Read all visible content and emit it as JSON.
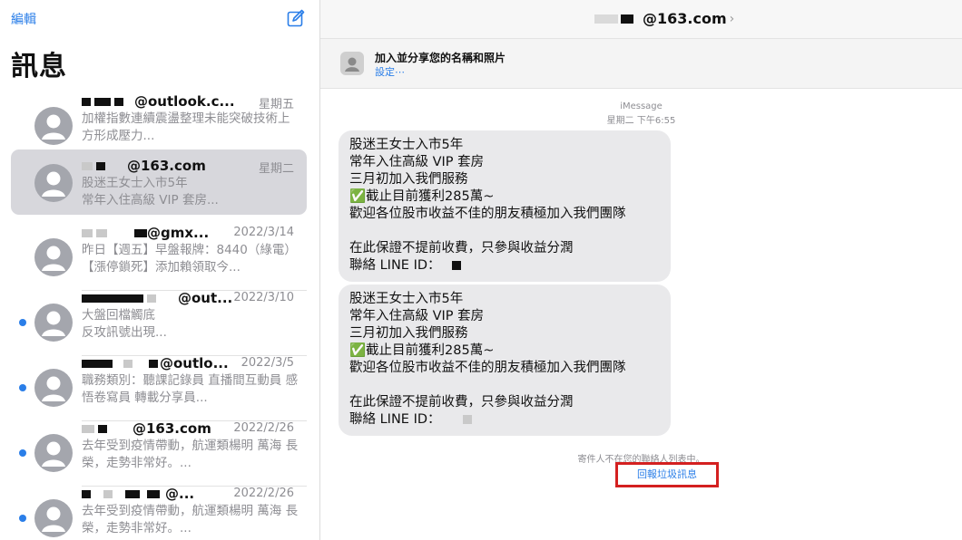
{
  "sidebar": {
    "edit_label": "編輯",
    "title": "訊息",
    "conversations": [
      {
        "sender": "@outlook.c...",
        "date": "星期五",
        "preview": "加權指數連續震盪整理未能突破技術上方形成壓力...",
        "unread": false,
        "selected": false
      },
      {
        "sender": "@163.com",
        "date": "星期二",
        "preview": "股迷王女士入市5年\n常年入住高級 VIP 套房...",
        "unread": false,
        "selected": true
      },
      {
        "sender": "@gmx...",
        "date": "2022/3/14",
        "preview": "昨日【週五】早盤報牌：8440（綠電）【漲停鎖死】添加賴領取今...",
        "unread": false,
        "selected": false
      },
      {
        "sender": "@out...",
        "date": "2022/3/10",
        "preview": "大盤回檔觸底\n反攻訊號出現...",
        "unread": true,
        "selected": false
      },
      {
        "sender": "@outlo...",
        "date": "2022/3/5",
        "preview": "職務類別：聽課記錄員 直播間互動員 感悟卷寫員 轉載分享員...",
        "unread": true,
        "selected": false
      },
      {
        "sender": "@163.com",
        "date": "2022/2/26",
        "preview": "去年受到疫情帶動，航運類楊明 萬海 長榮，走勢非常好。...",
        "unread": true,
        "selected": false
      },
      {
        "sender": "@...",
        "date": "2022/2/26",
        "preview": "去年受到疫情帶動，航運類楊明 萬海 長榮，走勢非常好。...",
        "unread": true,
        "selected": false
      }
    ]
  },
  "header": {
    "address": "@163.com"
  },
  "banner": {
    "title": "加入並分享您的名稱和照片",
    "subtitle": "設定⋯"
  },
  "thread": {
    "service": "iMessage",
    "timestamp": "星期二 下午6:55",
    "messages": [
      {
        "lines": [
          "股迷王女士入市5年",
          "常年入住高級 VIP 套房",
          "三月初加入我們服務",
          "✅截止目前獲利285萬~",
          "歡迎各位股市收益不佳的朋友積極加入我們團隊",
          "",
          "在此保證不提前收費，只參與收益分潤",
          "聯絡 LINE ID："
        ]
      },
      {
        "lines": [
          "股迷王女士入市5年",
          "常年入住高級 VIP 套房",
          "三月初加入我們服務",
          "✅截止目前獲利285萬~",
          "歡迎各位股市收益不佳的朋友積極加入我們團隊",
          "",
          "在此保證不提前收費，只參與收益分潤",
          "聯絡 LINE ID："
        ]
      }
    ],
    "not_in_contacts": "寄件人不在您的聯絡人列表中。",
    "report_junk": "回報垃圾訊息"
  },
  "colors": {
    "accent": "#2a7ee8",
    "bubble": "#e9e9eb",
    "highlight_box": "#d42020"
  }
}
